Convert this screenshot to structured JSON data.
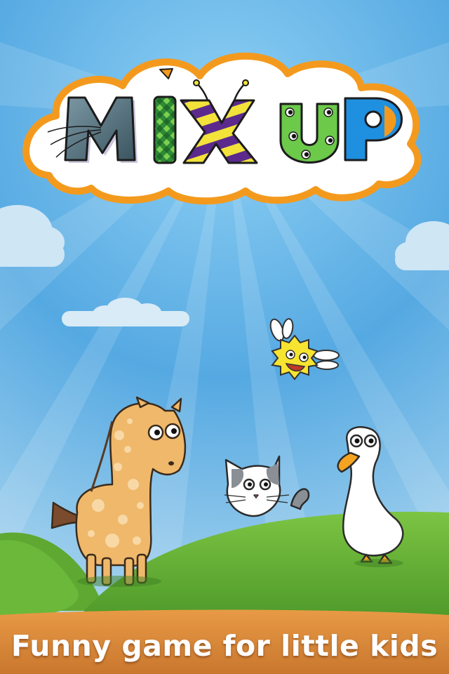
{
  "title": {
    "letters": [
      "M",
      "I",
      "X",
      "U",
      "P"
    ]
  },
  "tagline": "Funny game for little kids",
  "characters": [
    "giraffe",
    "cat",
    "goose",
    "sun-bug"
  ],
  "colors": {
    "sky_top": "#2f8fd6",
    "sky_bottom": "#cfe9f6",
    "hill": "#6fb33a",
    "ground": "#d98a3a",
    "cloud_outline": "#f39a1e",
    "letter_m": "#4d6a78",
    "letter_i": "#3aa33a",
    "letter_x_purple": "#5b2a8c",
    "letter_x_yellow": "#f2e23a",
    "letter_u": "#6cc94a",
    "letter_p": "#1f8fe0"
  }
}
